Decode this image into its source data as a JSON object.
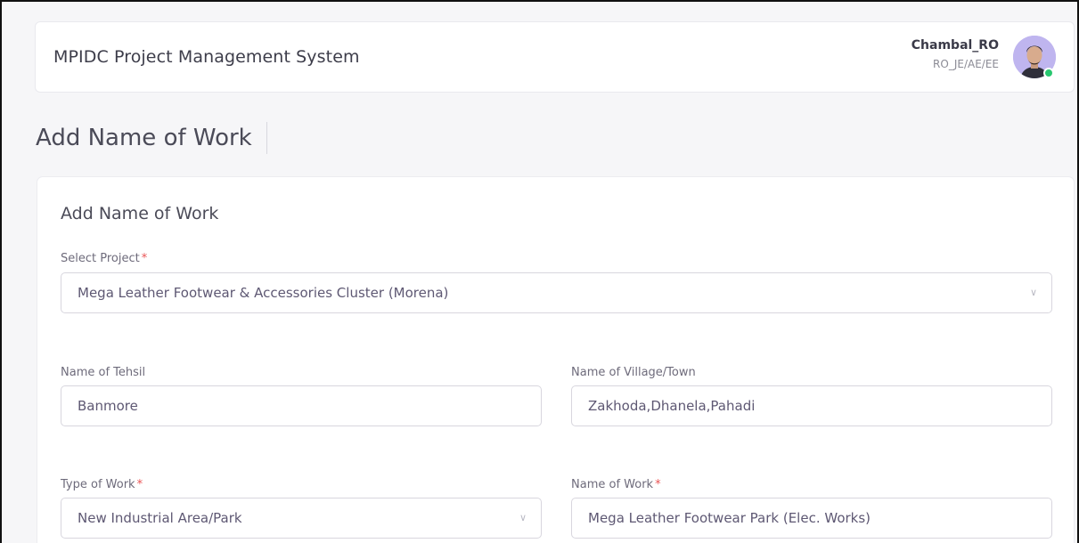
{
  "header": {
    "app_title": "MPIDC Project Management System",
    "user_name": "Chambal_RO",
    "user_role": "RO_JE/AE/EE",
    "status_color": "#28c76f"
  },
  "page": {
    "title": "Add Name of Work"
  },
  "form": {
    "card_title": "Add Name of Work",
    "required_marker": "*",
    "select_project": {
      "label": "Select Project",
      "value": "Mega Leather Footwear & Accessories Cluster (Morena)",
      "icon": "chevron-down-icon"
    },
    "tehsil": {
      "label": "Name of Tehsil",
      "value": "Banmore"
    },
    "village": {
      "label": "Name of Village/Town",
      "value": "Zakhoda,Dhanela,Pahadi"
    },
    "type_of_work": {
      "label": "Type of Work",
      "value": "New Industrial Area/Park",
      "icon": "chevron-down-icon"
    },
    "name_of_work": {
      "label": "Name of Work",
      "value": "Mega Leather Footwear Park (Elec. Works)"
    }
  }
}
